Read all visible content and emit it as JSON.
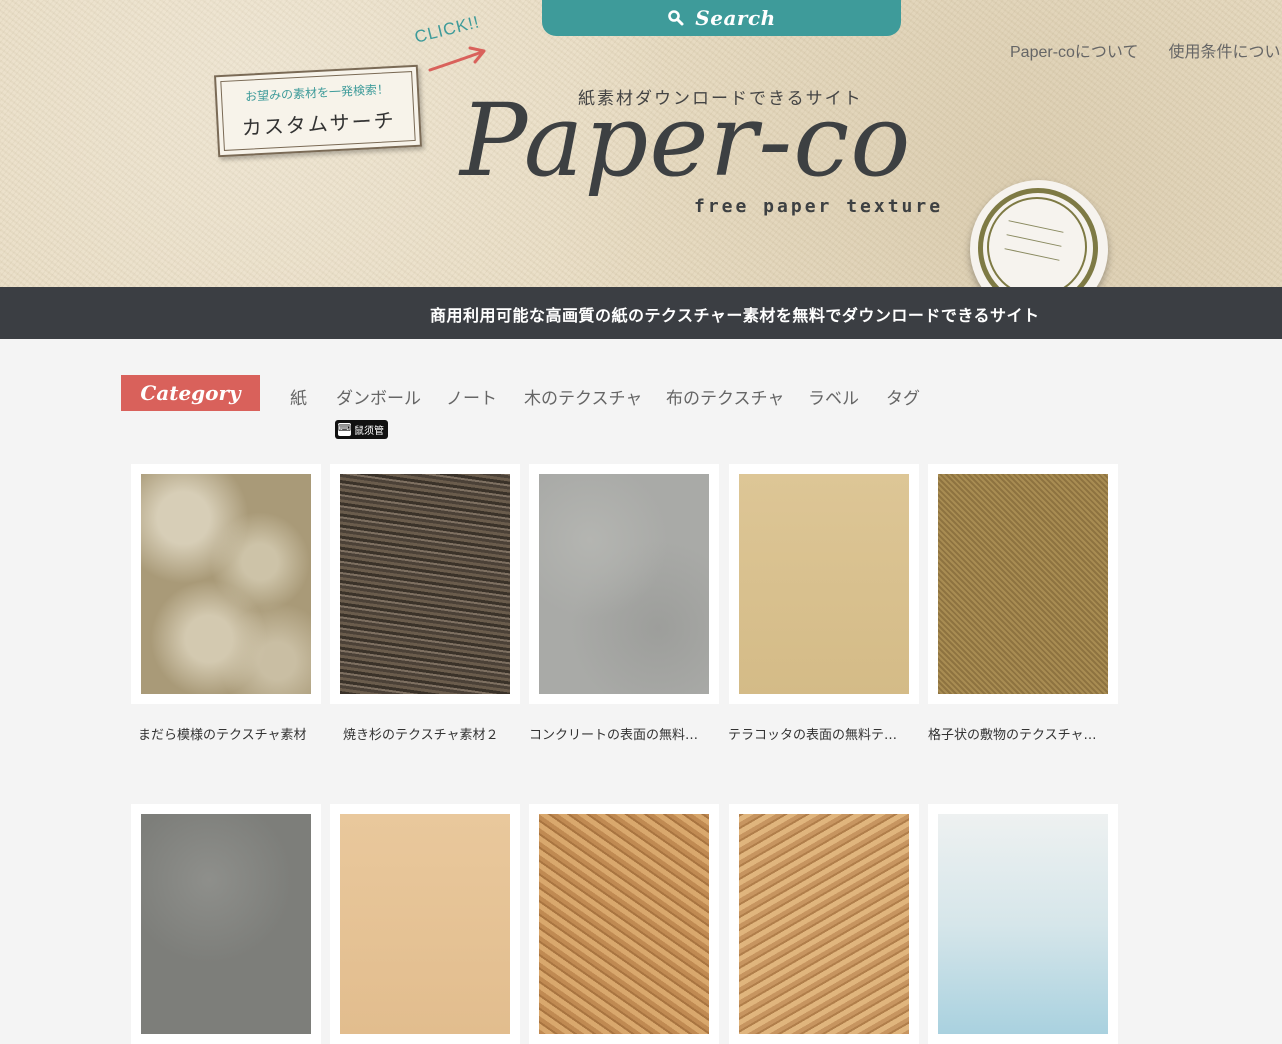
{
  "header": {
    "search_label": "Search",
    "nav": [
      "Paper-coについて",
      "使用条件につい"
    ],
    "click_text": "CLICK!!",
    "custom_search": {
      "subtitle": "お望みの素材を一発検索！",
      "title": "カスタムサーチ"
    },
    "logo": {
      "subtitle": "紙素材ダウンロードできるサイト",
      "name": "Paper-co",
      "tagline": "free paper texture"
    }
  },
  "band": {
    "text": "商用利用可能な高画質の紙のテクスチャー素材を無料でダウンロードできるサイト"
  },
  "category": {
    "badge": "Category",
    "items": [
      "紙",
      "ダンボール",
      "ノート",
      "木のテクスチャ",
      "布のテクスチャ",
      "ラベル",
      "タグ"
    ],
    "mini_badge": "鼠须管"
  },
  "grid": {
    "row1": [
      {
        "title": "まだら模様のテクスチャ素材",
        "swatch": "marble-beige"
      },
      {
        "title": "焼き杉のテクスチャ素材２",
        "swatch": "burnt-wood"
      },
      {
        "title": "コンクリートの表面の無料テクスチャ素材",
        "swatch": "concrete"
      },
      {
        "title": "テラコッタの表面の無料テクスチャ素材",
        "swatch": "terracotta"
      },
      {
        "title": "格子状の敷物のテクスチャ素材",
        "swatch": "lattice-mat"
      }
    ],
    "row2": [
      {
        "swatch": "dark-concrete"
      },
      {
        "swatch": "plain-wood"
      },
      {
        "swatch": "osb-board"
      },
      {
        "swatch": "osb-board-light"
      },
      {
        "swatch": "blue-watercolor"
      }
    ]
  },
  "colors": {
    "accent_teal": "#3e9b9a",
    "category_red": "#d9615b",
    "band": "#3b3e43",
    "background": "#f4f4f4"
  }
}
